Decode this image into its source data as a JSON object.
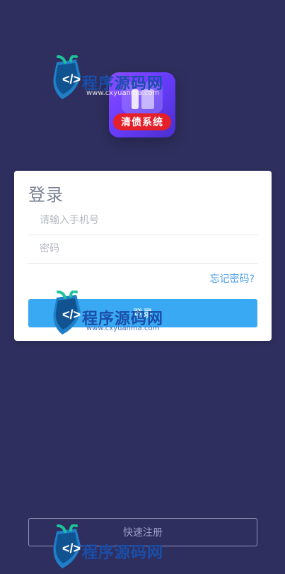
{
  "app_logo": {
    "ribbon_text": "清债系统"
  },
  "login": {
    "title": "登录",
    "phone_placeholder": "请输入手机号",
    "password_placeholder": "密码",
    "forgot_label": "忘记密码?",
    "submit_label": "登录"
  },
  "register": {
    "label": "快速注册"
  },
  "watermark": {
    "brand_text": "程序源码网",
    "url_text": "www.cxyuanma.com"
  },
  "colors": {
    "background": "#2f2f5f",
    "primary": "#3aa9f3",
    "link": "#4a9eea"
  }
}
